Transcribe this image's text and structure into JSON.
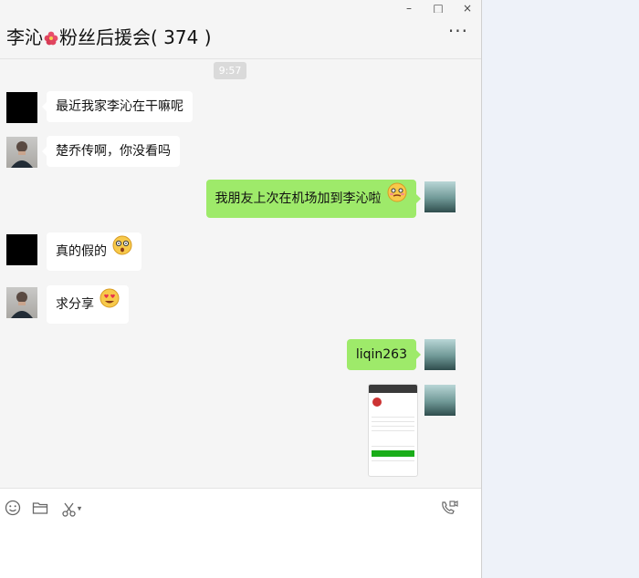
{
  "window": {
    "controls": {
      "minimize": "–",
      "maximize": "□",
      "close": "×"
    }
  },
  "header": {
    "title_pre": "李沁",
    "title_post": "粉丝后援会",
    "member_count": "( 374 )",
    "more_label": "···"
  },
  "chat": {
    "timestamp": "9:57",
    "messages": [
      {
        "side": "left",
        "avatar": "black",
        "text": "最近我家李沁在干嘛呢"
      },
      {
        "side": "left",
        "avatar": "man",
        "text": "楚乔传啊，你没看吗"
      },
      {
        "side": "right",
        "avatar": "sea",
        "text": "我朋友上次在机场加到李沁啦",
        "emoji": "awkward-emoji"
      },
      {
        "side": "left",
        "avatar": "black",
        "text": "真的假的",
        "emoji": "shocked-emoji"
      },
      {
        "side": "left",
        "avatar": "man",
        "text": "求分享",
        "emoji": "heart-eyes-emoji"
      },
      {
        "side": "right",
        "avatar": "sea",
        "text": "liqin263"
      },
      {
        "side": "right",
        "avatar": "sea",
        "image": "screenshot-thumbnail"
      }
    ]
  },
  "toolbar": {
    "icons": [
      "emoji-icon",
      "folder-icon",
      "scissors-icon",
      "video-call-icon"
    ],
    "dropdown_caret": "▾"
  },
  "colors": {
    "self_bubble": "#9eea6a",
    "other_bubble": "#ffffff",
    "chat_background": "#f5f5f5"
  }
}
